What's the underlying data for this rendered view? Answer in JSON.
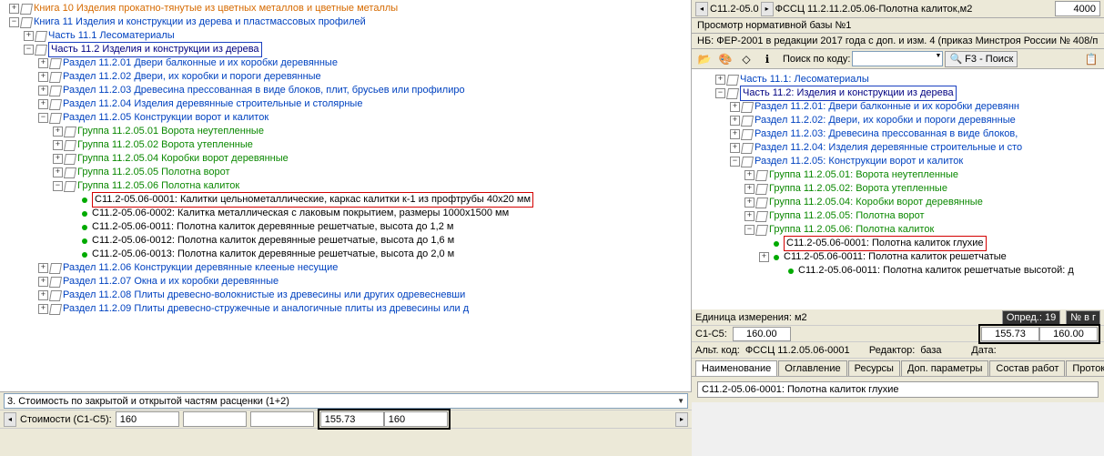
{
  "left_tree": {
    "book10": "Книга 10 Изделия прокатно-тянутые из цветных металлов и цветные металлы",
    "book11": "Книга 11 Изделия и конструкции из дерева и пластмассовых профилей",
    "part11_1": "Часть 11.1 Лесоматериалы",
    "part11_2": "Часть 11.2 Изделия и конструкции из дерева",
    "r_11_2_01": "Раздел 11.2.01 Двери балконные и их коробки деревянные",
    "r_11_2_02": "Раздел 11.2.02 Двери, их коробки и пороги деревянные",
    "r_11_2_03": "Раздел 11.2.03 Древесина прессованная в виде блоков, плит, брусьев или профилиро",
    "r_11_2_04": "Раздел 11.2.04 Изделия деревянные строительные и столярные",
    "r_11_2_05": "Раздел 11.2.05 Конструкции ворот и калиток",
    "g_01": "Группа 11.2.05.01 Ворота неутепленные",
    "g_02": "Группа 11.2.05.02 Ворота утепленные",
    "g_04": "Группа 11.2.05.04 Коробки ворот деревянные",
    "g_05": "Группа 11.2.05.05 Полотна ворот",
    "g_06": "Группа 11.2.05.06 Полотна калиток",
    "item_0001": "С11.2-05.06-0001: Калитки цельнометаллические, каркас калитки к-1 из профтрубы 40x20 мм",
    "item_0002": "С11.2-05.06-0002: Калитка металлическая с лаковым покрытием, размеры 1000х1500 мм",
    "item_0011": "С11.2-05.06-0011: Полотна калиток деревянные решетчатые, высота до 1,2 м",
    "item_0012": "С11.2-05.06-0012: Полотна калиток деревянные решетчатые, высота до 1,6 м",
    "item_0013": "С11.2-05.06-0013: Полотна калиток деревянные решетчатые, высота до 2,0 м",
    "r_11_2_06": "Раздел 11.2.06 Конструкции деревянные клееные несущие",
    "r_11_2_07": "Раздел 11.2.07 Окна и их коробки деревянные",
    "r_11_2_08": "Раздел 11.2.08 Плиты древесно-волокнистые из древесины или других одревесневши",
    "r_11_2_09": "Раздел 11.2.09 Плиты древесно-стружечные и аналогичные плиты из древесины или д"
  },
  "left_bottom": {
    "row1": "3. Стоимость по закрытой и открытой частям расценки (1+2)",
    "cost_label": "Стоимости (С1-С5):",
    "v160": "160",
    "v155": "155.73"
  },
  "right_top": {
    "crumb_prefix": "С11.2-05.0",
    "crumb_mid": "ФССЦ 11.2.11.2.05.06-Полотна калиток,м2",
    "crumb_val": "4000",
    "title": "Просмотр нормативной базы №1",
    "nb": "НБ:  ФЕР-2001 в редакции 2017 года с доп. и изм. 4 (приказ Минстроя России № 408/п",
    "search_label": "Поиск по коду:",
    "search_btn": "F3 - Поиск"
  },
  "right_tree": {
    "part11_1": "Часть 11.1:  Лесоматериалы",
    "part11_2": "Часть 11.2:  Изделия и конструкции из дерева",
    "r_01": "Раздел 11.2.01:  Двери балконные и их коробки деревянн",
    "r_02": "Раздел 11.2.02:  Двери, их коробки и пороги деревянные",
    "r_03": "Раздел 11.2.03:  Древесина прессованная в виде блоков,",
    "r_04": "Раздел 11.2.04:  Изделия деревянные строительные и сто",
    "r_05": "Раздел 11.2.05:  Конструкции ворот и калиток",
    "g_01": "Группа 11.2.05.01:  Ворота неутепленные",
    "g_02": "Группа 11.2.05.02:  Ворота утепленные",
    "g_04": "Группа 11.2.05.04:  Коробки ворот деревянные",
    "g_05": "Группа 11.2.05.05:  Полотна ворот",
    "g_06": "Группа 11.2.05.06:  Полотна калиток",
    "item_0001": "С11.2-05.06-0001:  Полотна калиток глухие",
    "item_0011": "С11.2-05.06-0011:  Полотна калиток решетчатые",
    "item_0011b": "С11.2-05.06-0011:  Полотна калиток решетчатые высотой: д"
  },
  "right_bottom": {
    "unit_label": "Единица измерения: м2",
    "opred": "Опред.: 19",
    "numvg": "№ в г",
    "c1c5": "С1-С5:",
    "v160": "160.00",
    "v155": "155.73",
    "alt_label": "Альт. код:",
    "alt_val": "ФССЦ 11.2.05.06-0001",
    "ed_label": "Редактор:",
    "ed_val": "база",
    "date_label": "Дата:",
    "tabs": [
      "Наименование",
      "Оглавление",
      "Ресурсы",
      "Доп. параметры",
      "Состав работ",
      "Протоко"
    ],
    "tab_content": "С11.2-05.06-0001: Полотна калиток глухие"
  }
}
